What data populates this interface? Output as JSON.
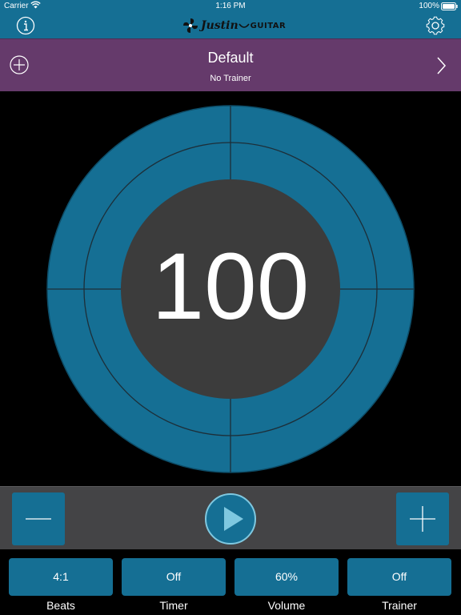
{
  "status_bar": {
    "carrier": "Carrier",
    "time": "1:16 PM",
    "battery": "100%"
  },
  "nav": {
    "logo_script": "Justin",
    "logo_word": "GUITAR",
    "info_icon": "info-icon",
    "settings_icon": "gear-icon"
  },
  "preset": {
    "name": "Default",
    "trainer_status": "No Trainer"
  },
  "tempo": {
    "bpm": "100"
  },
  "settings": [
    {
      "value": "4:1",
      "label": "Beats"
    },
    {
      "value": "Off",
      "label": "Timer"
    },
    {
      "value": "60%",
      "label": "Volume"
    },
    {
      "value": "Off",
      "label": "Trainer"
    }
  ],
  "colors": {
    "primary_blue": "#156f94",
    "preset_purple": "#653a6b",
    "dial_center": "#3c3c3c",
    "control_bar": "#444446",
    "play_accent": "#7fc8e0"
  }
}
